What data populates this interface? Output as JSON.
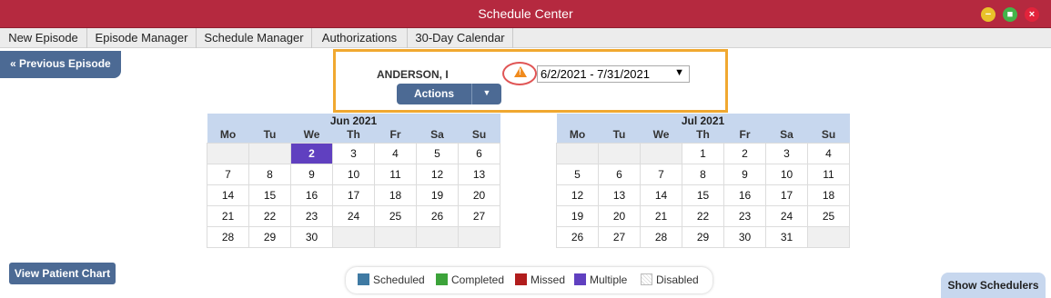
{
  "window": {
    "title": "Schedule Center"
  },
  "menu": {
    "items": [
      "New Episode",
      "Episode Manager",
      "Schedule Manager",
      "Authorizations",
      "30-Day Calendar"
    ]
  },
  "header": {
    "prev_episode": "« Previous Episode",
    "patient_name": "ANDERSON, I",
    "episode_range": "6/2/2021 - 7/31/2021",
    "actions_label": "Actions",
    "warning_icon": "warning-triangle-icon"
  },
  "calendars": [
    {
      "month": "Jun 2021",
      "weekdays": [
        "Mo",
        "Tu",
        "We",
        "Th",
        "Fr",
        "Sa",
        "Su"
      ],
      "weeks": [
        [
          "",
          "",
          "2",
          "3",
          "4",
          "5",
          "6"
        ],
        [
          "7",
          "8",
          "9",
          "10",
          "11",
          "12",
          "13"
        ],
        [
          "14",
          "15",
          "16",
          "17",
          "18",
          "19",
          "20"
        ],
        [
          "21",
          "22",
          "23",
          "24",
          "25",
          "26",
          "27"
        ],
        [
          "28",
          "29",
          "30",
          "",
          "",
          "",
          ""
        ]
      ],
      "highlighted_day": "2"
    },
    {
      "month": "Jul 2021",
      "weekdays": [
        "Mo",
        "Tu",
        "We",
        "Th",
        "Fr",
        "Sa",
        "Su"
      ],
      "weeks": [
        [
          "",
          "",
          "",
          "1",
          "2",
          "3",
          "4"
        ],
        [
          "5",
          "6",
          "7",
          "8",
          "9",
          "10",
          "11"
        ],
        [
          "12",
          "13",
          "14",
          "15",
          "16",
          "17",
          "18"
        ],
        [
          "19",
          "20",
          "21",
          "22",
          "23",
          "24",
          "25"
        ],
        [
          "26",
          "27",
          "28",
          "29",
          "30",
          "31",
          ""
        ]
      ],
      "highlighted_day": ""
    }
  ],
  "footer": {
    "view_patient_chart": "View Patient Chart",
    "show_schedulers": "Show Schedulers"
  },
  "legend": [
    {
      "label": "Scheduled",
      "color": "#3f7aa3"
    },
    {
      "label": "Completed",
      "color": "#3ca33a"
    },
    {
      "label": "Missed",
      "color": "#b11d1d"
    },
    {
      "label": "Multiple",
      "color": "#6040c0"
    },
    {
      "label": "Disabled",
      "color": ""
    }
  ],
  "colors": {
    "titlebar": "#b5293f",
    "accent": "#4c6a94",
    "calendar_header": "#c7d7ee",
    "highlight_box": "#f0a830"
  }
}
